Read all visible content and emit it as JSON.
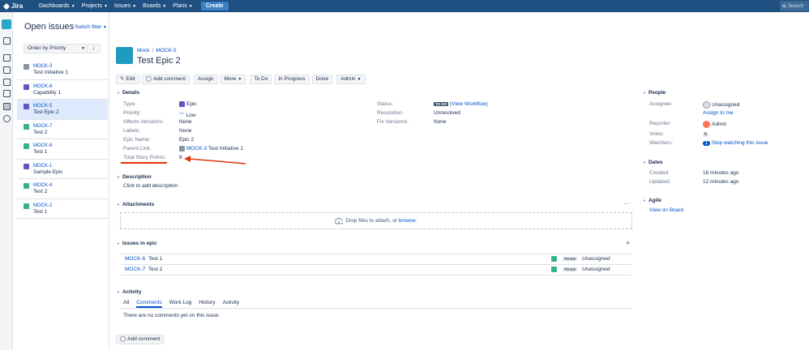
{
  "topbar": {
    "brand": "Jira",
    "nav": [
      "Dashboards",
      "Projects",
      "Issues",
      "Boards",
      "Plans"
    ],
    "create": "Create",
    "search_placeholder": "Search"
  },
  "issues_pane": {
    "title": "Open issues",
    "switch_filter": "Switch filter",
    "order_by": "Order by Priority",
    "sort_icon": "arrow-down-icon",
    "items": [
      {
        "key": "MOCK-3",
        "summary": "Test Initiative 1",
        "type": "initiative",
        "color": "#8993a4"
      },
      {
        "key": "MOCK-8",
        "summary": "Capability 1",
        "type": "capability",
        "color": "#6554c0"
      },
      {
        "key": "MOCK-5",
        "summary": "Test Epic 2",
        "type": "epic",
        "color": "#6554c0",
        "active": true
      },
      {
        "key": "MOCK-7",
        "summary": "Test 2",
        "type": "story",
        "color": "#36b37e"
      },
      {
        "key": "MOCK-6",
        "summary": "Test 1",
        "type": "story",
        "color": "#36b37e"
      },
      {
        "key": "MOCK-1",
        "summary": "Sample Epic",
        "type": "epic",
        "color": "#6554c0"
      },
      {
        "key": "MOCK-4",
        "summary": "Test 2",
        "type": "story",
        "color": "#36b37e"
      },
      {
        "key": "MOCK-2",
        "summary": "Test 1",
        "type": "story",
        "color": "#36b37e"
      }
    ]
  },
  "issue": {
    "project": "Mock",
    "key": "MOCK-5",
    "title": "Test Epic 2",
    "toolbar": {
      "edit": "Edit",
      "add_comment": "Add comment",
      "assign": "Assign",
      "more": "More",
      "todo": "To Do",
      "in_progress": "In Progress",
      "done": "Done",
      "admin": "Admin"
    },
    "details": {
      "heading": "Details",
      "type_label": "Type:",
      "type_value": "Epic",
      "priority_label": "Priority:",
      "priority_value": "Low",
      "affects_label": "Affects Version/s:",
      "affects_value": "None",
      "labels_label": "Labels:",
      "labels_value": "None",
      "epic_name_label": "Epic Name:",
      "epic_name_value": "Epic 2",
      "parent_label": "Parent Link:",
      "parent_key": "MOCK-3",
      "parent_summary": "Test Initiative 1",
      "story_points_label": "Total Story Points:",
      "story_points_value": "8",
      "status_label": "Status:",
      "status_value": "TO DO",
      "view_workflow": "View Workflow",
      "resolution_label": "Resolution:",
      "resolution_value": "Unresolved",
      "fix_label": "Fix Version/s:",
      "fix_value": "None"
    },
    "description": {
      "heading": "Description",
      "placeholder": "Click to add description"
    },
    "attachments": {
      "heading": "Attachments",
      "drop_text": "Drop files to attach, or",
      "browse": "browse."
    },
    "issues_in_epic": {
      "heading": "Issues in epic",
      "rows": [
        {
          "key": "MOCK-6",
          "summary": "Test 1",
          "status": "TO DO",
          "assignee": "Unassigned"
        },
        {
          "key": "MOCK-7",
          "summary": "Test 2",
          "status": "TO DO",
          "assignee": "Unassigned"
        }
      ]
    },
    "activity": {
      "heading": "Activity",
      "tabs": [
        "All",
        "Comments",
        "Work Log",
        "History",
        "Activity"
      ],
      "active_tab": "Comments",
      "empty": "There are no comments yet on this issue.",
      "add_comment": "Add comment"
    }
  },
  "people": {
    "heading": "People",
    "assignee_label": "Assignee:",
    "assignee_value": "Unassigned",
    "assign_to_me": "Assign to me",
    "reporter_label": "Reporter:",
    "reporter_value": "Admin",
    "votes_label": "Votes:",
    "votes_value": "0",
    "watchers_label": "Watchers:",
    "watchers_count": "1",
    "stop_watching": "Stop watching this issue"
  },
  "dates": {
    "heading": "Dates",
    "created_label": "Created:",
    "created_value": "16 minutes ago",
    "updated_label": "Updated:",
    "updated_value": "12 minutes ago"
  },
  "agile": {
    "heading": "Agile",
    "view_on_board": "View on Board"
  }
}
